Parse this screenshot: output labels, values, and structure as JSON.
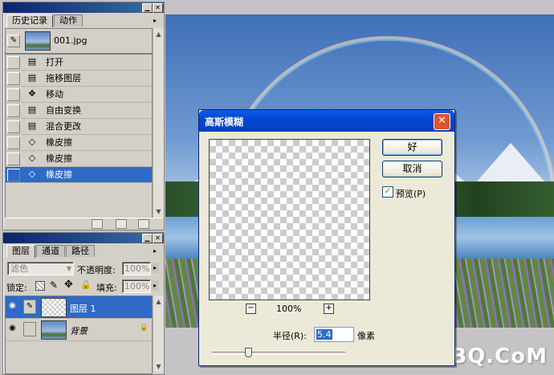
{
  "history_panel": {
    "tabs": [
      "历史记录",
      "动作"
    ],
    "snapshot_name": "001.jpg",
    "items": [
      {
        "label": "打开",
        "icon": "document-step-icon",
        "selected": false
      },
      {
        "label": "拖移图层",
        "icon": "document-step-icon",
        "selected": false
      },
      {
        "label": "移动",
        "icon": "move-tool-icon",
        "selected": false
      },
      {
        "label": "自由变换",
        "icon": "document-step-icon",
        "selected": false
      },
      {
        "label": "混合更改",
        "icon": "document-step-icon",
        "selected": false
      },
      {
        "label": "橡皮擦",
        "icon": "eraser-icon",
        "selected": false
      },
      {
        "label": "橡皮擦",
        "icon": "eraser-icon",
        "selected": false
      },
      {
        "label": "橡皮擦",
        "icon": "eraser-icon",
        "selected": true
      }
    ]
  },
  "layers_panel": {
    "tabs": [
      "图层",
      "通道",
      "路径"
    ],
    "blend_mode": "滤色",
    "opacity_label": "不透明度:",
    "opacity_value": "100%",
    "lock_label": "锁定:",
    "fill_label": "填充:",
    "fill_value": "100%",
    "layers": [
      {
        "name": "图层 1",
        "selected": true,
        "locked": false
      },
      {
        "name": "背景",
        "selected": false,
        "locked": true
      }
    ]
  },
  "dialog": {
    "title": "高斯模糊",
    "close_glyph": "✕",
    "ok_label": "好",
    "cancel_label": "取消",
    "preview_label": "预览(P)",
    "preview_checked": true,
    "zoom_level": "100%",
    "zoom_out_glyph": "−",
    "zoom_in_glyph": "+",
    "radius_label": "半径(R):",
    "radius_value": "5.4",
    "radius_unit": "像素",
    "radius_slider_fraction": 0.27
  },
  "watermark": "UiBQ.CoM",
  "colors": {
    "selection": "#3169c6",
    "dialog_title": "#0046d6",
    "panel_bg": "#d4d0c8"
  }
}
